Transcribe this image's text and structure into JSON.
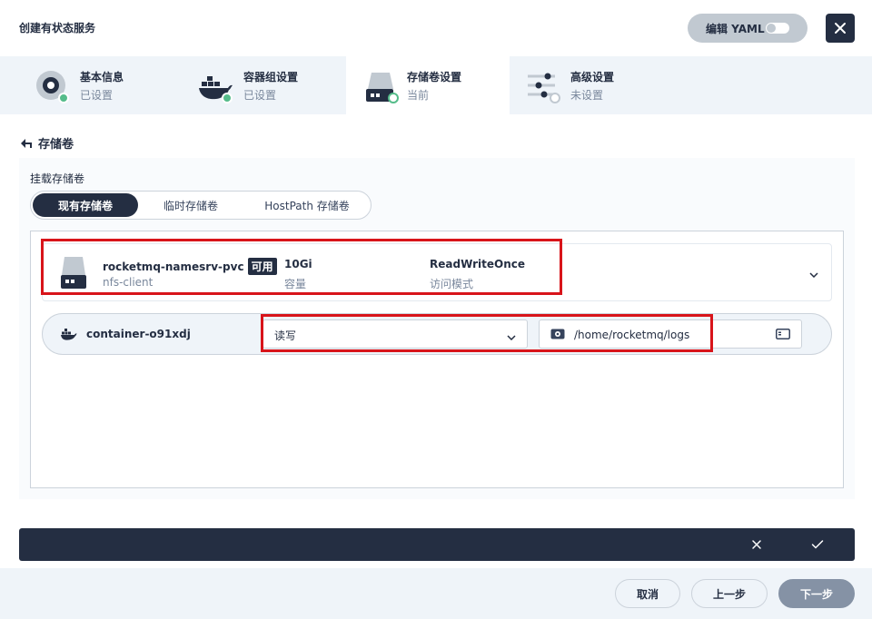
{
  "header": {
    "title": "创建有状态服务",
    "yaml_label": "编辑 YAML"
  },
  "steps": [
    {
      "label": "基本信息",
      "status": "已设置"
    },
    {
      "label": "容器组设置",
      "status": "已设置"
    },
    {
      "label": "存储卷设置",
      "status": "当前"
    },
    {
      "label": "高级设置",
      "status": "未设置"
    }
  ],
  "section": {
    "back_label": "存储卷"
  },
  "mount": {
    "label": "挂载存储卷",
    "tabs": [
      "现有存储卷",
      "临时存储卷",
      "HostPath 存储卷"
    ],
    "selected_tab": "现有存储卷"
  },
  "pvc": {
    "name": "rocketmq-namesrv-pvc",
    "badge": "可用",
    "storage_class": "nfs-client",
    "capacity": "10Gi",
    "capacity_label": "容量",
    "access_mode": "ReadWriteOnce",
    "access_mode_label": "访问模式"
  },
  "container": {
    "name": "container-o91xdj",
    "mode_value": "读写",
    "mount_path": "/home/rocketmq/logs"
  },
  "footer": {
    "cancel": "取消",
    "prev": "上一步",
    "next": "下一步"
  },
  "colors": {
    "dark": "#242e42",
    "success": "#55bc8a",
    "highlight": "#d8141a",
    "muted": "#79879c"
  }
}
